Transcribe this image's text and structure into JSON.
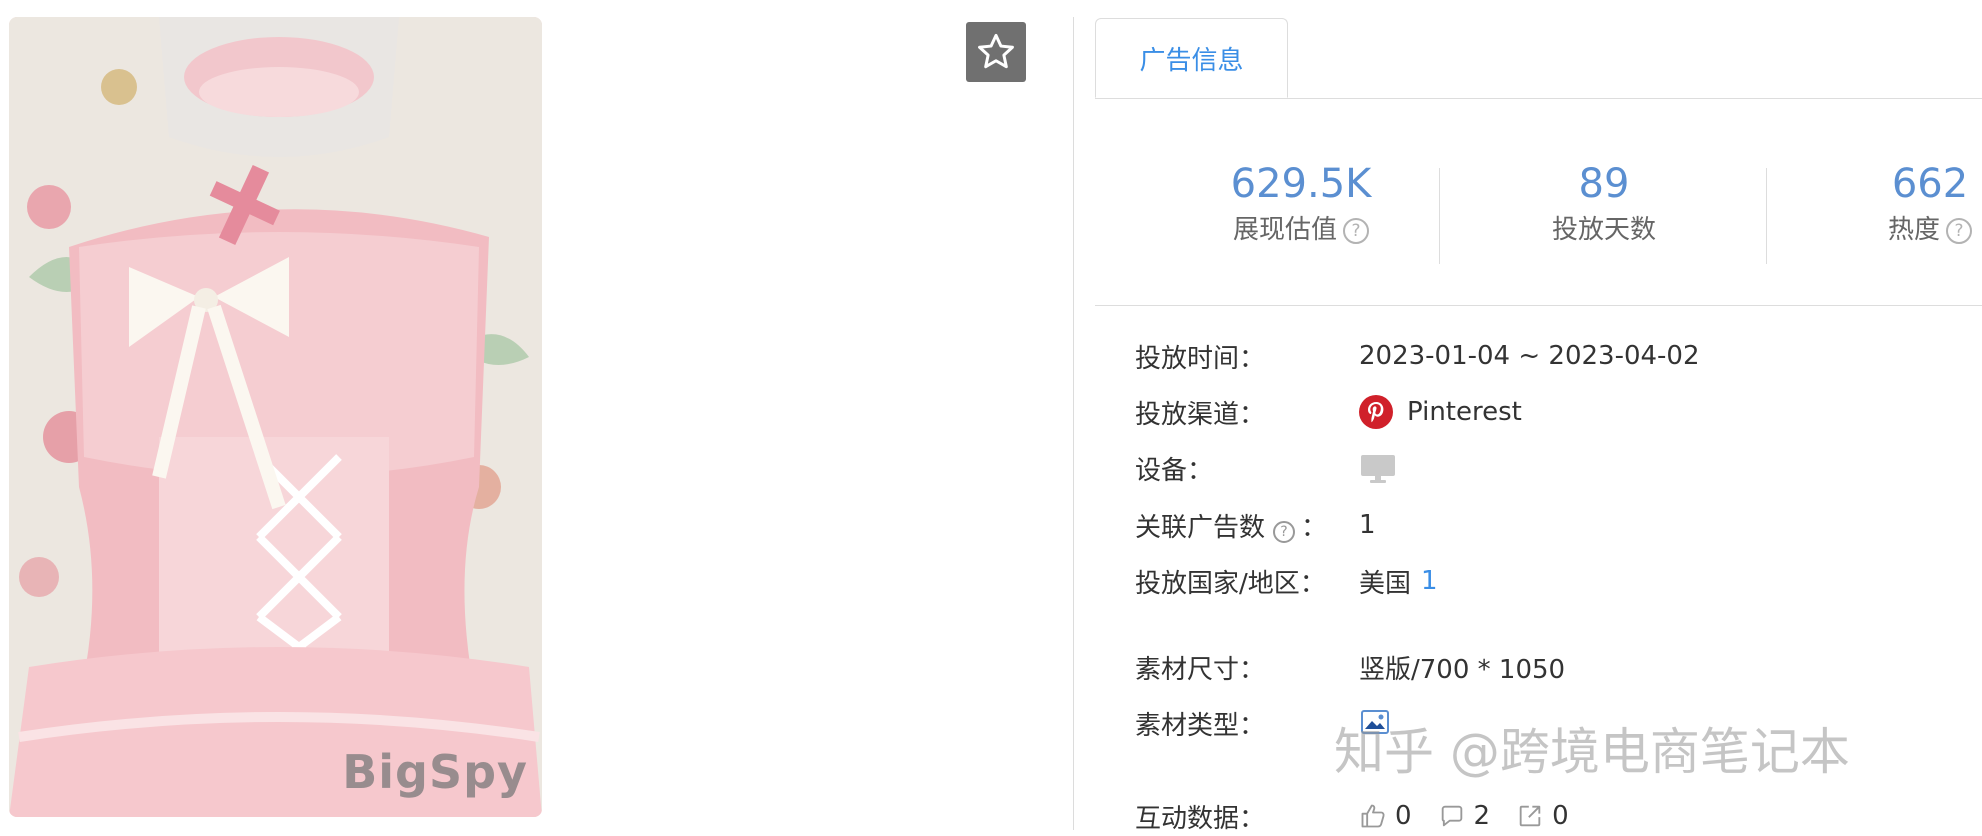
{
  "image": {
    "watermark": "BigSpy"
  },
  "favorite": {
    "icon": "star-icon"
  },
  "tabs": [
    {
      "label": "广告信息",
      "active": true
    }
  ],
  "stats": [
    {
      "value": "629.5K",
      "label": "展现估值",
      "help": "?"
    },
    {
      "value": "89",
      "label": "投放天数"
    },
    {
      "value": "662",
      "label": "热度",
      "help": "?"
    }
  ],
  "details": {
    "time": {
      "label": "投放时间：",
      "value": "2023-01-04 ~ 2023-04-02"
    },
    "channel": {
      "label": "投放渠道：",
      "value": "Pinterest",
      "icon": "pinterest-icon"
    },
    "device": {
      "label": "设备：",
      "icon": "desktop-icon"
    },
    "related": {
      "label_pre": "关联广告数",
      "label_post": "：",
      "help": "?",
      "value": "1"
    },
    "country": {
      "label": "投放国家/地区：",
      "value": "美国",
      "count": "1"
    },
    "size": {
      "label": "素材尺寸：",
      "value": "竖版/700 * 1050"
    },
    "type": {
      "label": "素材类型：",
      "icon": "image-icon"
    },
    "interaction": {
      "label": "互动数据：",
      "likes": "0",
      "comments": "2",
      "shares": "0"
    }
  },
  "overlay_watermark": "知乎 @跨境电商笔记本",
  "colors": {
    "accent": "#3a8ee6",
    "stat_value": "#5b8fd1",
    "pinterest": "#e60023"
  }
}
